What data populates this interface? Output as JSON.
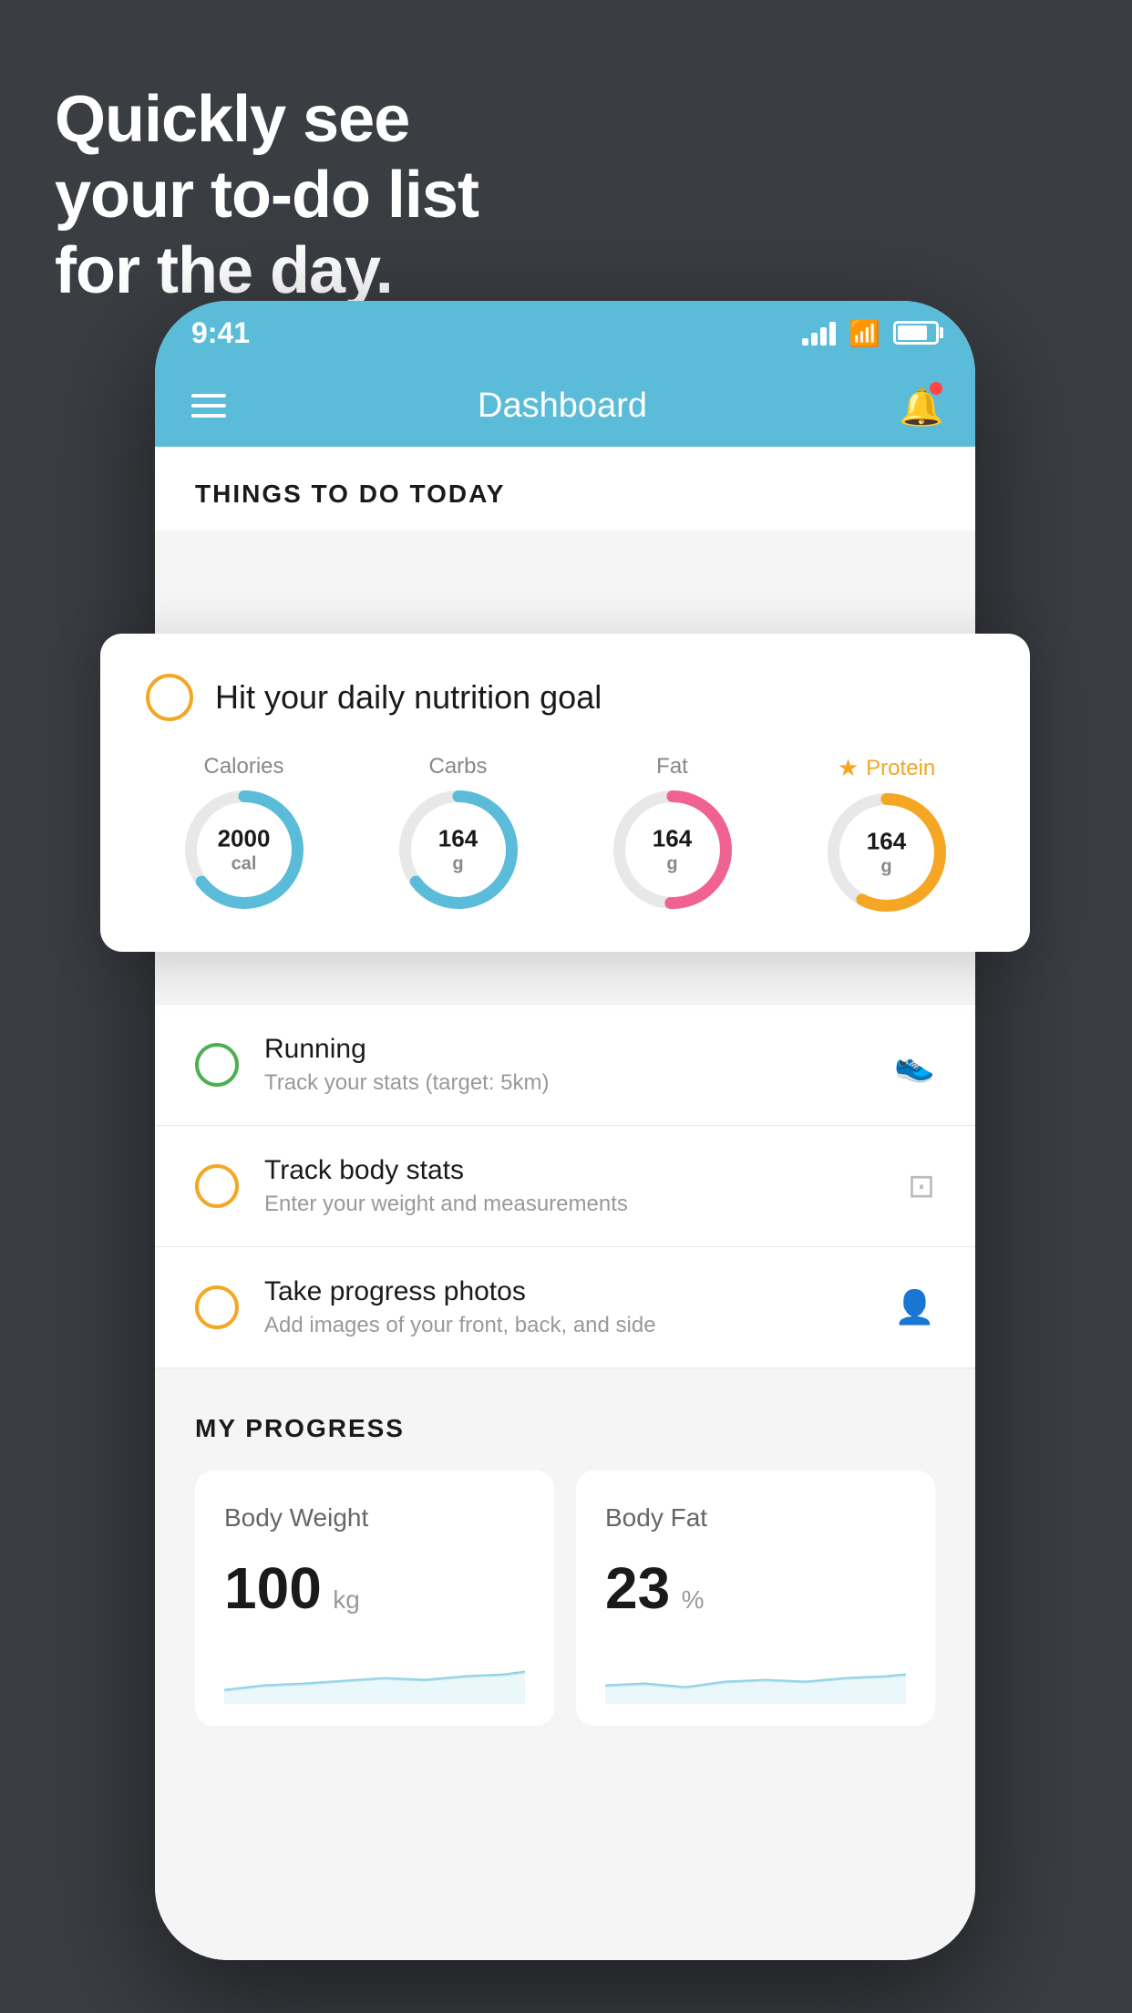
{
  "hero": {
    "line1": "Quickly see",
    "line2": "your to-do list",
    "line3": "for the day."
  },
  "phone": {
    "status": {
      "time": "9:41"
    },
    "nav": {
      "title": "Dashboard"
    },
    "section_header": "THINGS TO DO TODAY",
    "floating_card": {
      "title": "Hit your daily nutrition goal",
      "nutrition": [
        {
          "label": "Calories",
          "value": "2000",
          "unit": "cal",
          "type": "blue",
          "star": false
        },
        {
          "label": "Carbs",
          "value": "164",
          "unit": "g",
          "type": "blue",
          "star": false
        },
        {
          "label": "Fat",
          "value": "164",
          "unit": "g",
          "type": "pink",
          "star": false
        },
        {
          "label": "Protein",
          "value": "164",
          "unit": "g",
          "type": "gold",
          "star": true
        }
      ]
    },
    "todo_items": [
      {
        "title": "Running",
        "subtitle": "Track your stats (target: 5km)",
        "circle_color": "green",
        "icon": "👟"
      },
      {
        "title": "Track body stats",
        "subtitle": "Enter your weight and measurements",
        "circle_color": "yellow",
        "icon": "⚖️"
      },
      {
        "title": "Take progress photos",
        "subtitle": "Add images of your front, back, and side",
        "circle_color": "yellow",
        "icon": "👤"
      }
    ],
    "progress": {
      "header": "MY PROGRESS",
      "cards": [
        {
          "title": "Body Weight",
          "value": "100",
          "unit": "kg"
        },
        {
          "title": "Body Fat",
          "value": "23",
          "unit": "%"
        }
      ]
    }
  }
}
